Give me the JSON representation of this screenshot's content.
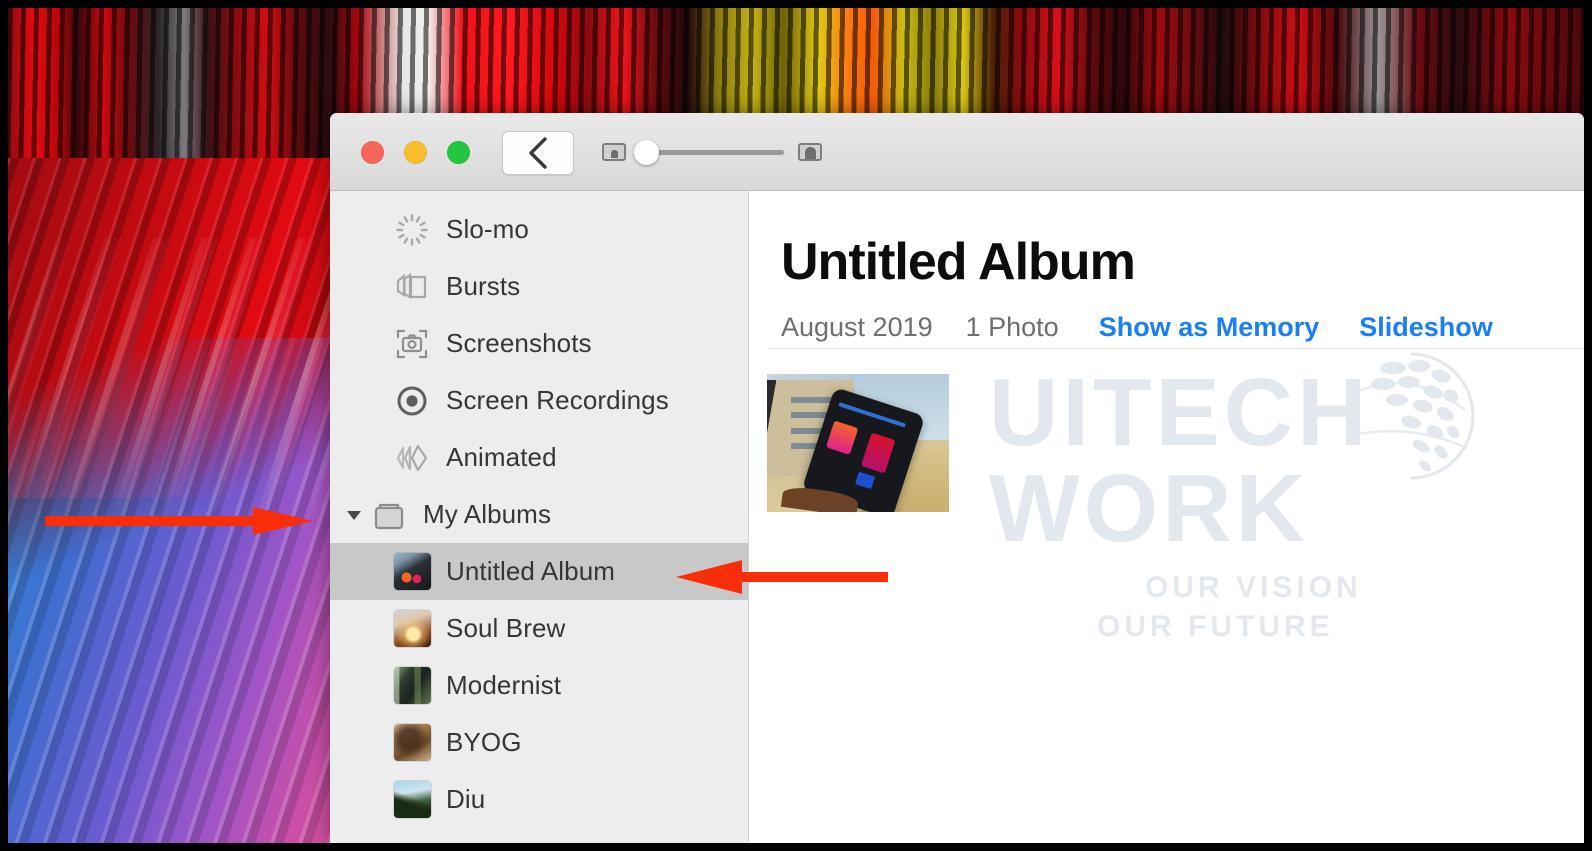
{
  "desktop": {
    "wallpaper_name": "macos-abstract-red-blue-streaks"
  },
  "window": {
    "app": "Photos",
    "traffic_lights": {
      "close_color": "#f9655b",
      "minimize_color": "#f9bd2e",
      "maximize_color": "#25c53f"
    },
    "toolbar": {
      "back_label": "‹",
      "back_icon": "chevron-left-icon",
      "zoom_small_icon": "small-thumbnail-icon",
      "zoom_large_icon": "large-thumbnail-icon",
      "zoom_value": "0"
    }
  },
  "sidebar": {
    "items": [
      {
        "label": "Slo-mo",
        "icon": "slo-mo-icon",
        "type": "smart",
        "selected": false,
        "indent": true
      },
      {
        "label": "Bursts",
        "icon": "bursts-icon",
        "type": "smart",
        "selected": false,
        "indent": true
      },
      {
        "label": "Screenshots",
        "icon": "screenshots-icon",
        "type": "smart",
        "selected": false,
        "indent": true
      },
      {
        "label": "Screen Recordings",
        "icon": "screen-recordings-icon",
        "type": "smart",
        "selected": false,
        "indent": true
      },
      {
        "label": "Animated",
        "icon": "animated-icon",
        "type": "smart",
        "selected": false,
        "indent": true
      }
    ],
    "group": {
      "label": "My Albums",
      "icon": "albums-folder-icon",
      "disclosure": "expanded",
      "disclosure_icon": "triangle-down-icon"
    },
    "albums": [
      {
        "label": "Untitled Album",
        "icon": "album-thumbnail",
        "selected": true
      },
      {
        "label": "Soul Brew",
        "icon": "album-thumbnail",
        "selected": false
      },
      {
        "label": "Modernist",
        "icon": "album-thumbnail",
        "selected": false
      },
      {
        "label": "BYOG",
        "icon": "album-thumbnail",
        "selected": false
      },
      {
        "label": "Diu",
        "icon": "album-thumbnail",
        "selected": false
      }
    ]
  },
  "main": {
    "title": "Untitled Album",
    "date": "August 2019",
    "photo_count": "1 Photo",
    "show_as_memory": "Show as Memory",
    "slideshow": "Slideshow",
    "link_color": "#1a7ef5",
    "photos": [
      {
        "name": "phone-held-against-building-photo"
      }
    ]
  },
  "watermark": {
    "line1": "UITECH",
    "line2": "WORK",
    "tagline1": "OUR VISION",
    "tagline2": "OUR FUTURE",
    "globe_icon": "globe-icon",
    "color": "#b9c6d6"
  },
  "annotations": {
    "arrow_color": "#fa2d0a",
    "arrows": [
      {
        "name": "arrow-pointing-to-my-albums",
        "direction": "right",
        "target": "My Albums"
      },
      {
        "name": "arrow-pointing-to-untitled-album",
        "direction": "left",
        "target": "Untitled Album"
      }
    ]
  }
}
